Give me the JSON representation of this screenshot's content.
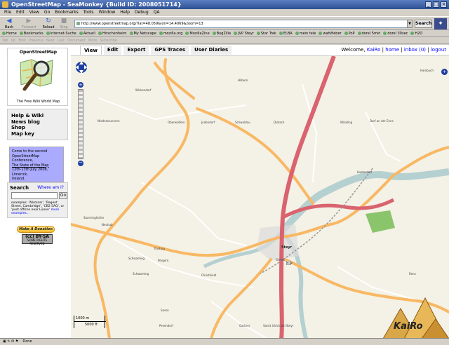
{
  "window": {
    "title": "OpenStreetMap - SeaMonkey {Build ID: 2008051714}"
  },
  "menu": [
    "File",
    "Edit",
    "View",
    "Go",
    "Bookmarks",
    "Tools",
    "Window",
    "Help",
    "Debug",
    "QA"
  ],
  "nav": {
    "back": "Back",
    "forward": "Forward",
    "reload": "Reload",
    "stop": "Stop",
    "url": "http://www.openstreetmap.org/?lat=48.059&lon=14.4069&zoom=13",
    "search": "Search"
  },
  "bookmarks": [
    "Home",
    "Bookmarks",
    "Internet-Suche",
    "Aktuell",
    "Hirschenheim",
    "My Netscape",
    "mozilla.org",
    "MozillaZine",
    "BugZilla",
    "JVP Steyr",
    "Star Trek",
    "ELBA",
    "mein tele",
    "wahlfieber",
    "PoP",
    "dorel 5min",
    "dorel 30sec",
    "H2O"
  ],
  "tabbar": [
    "Tab",
    "Up",
    "First",
    "Previous",
    "Next",
    "Last",
    "Document",
    "More",
    "Subscribe"
  ],
  "sidebar": {
    "logo_title": "OpenStreetMap",
    "logo_sub": "The Free Wiki World Map",
    "links": [
      "Help & Wiki",
      "News blog",
      "Shop",
      "Map key"
    ],
    "notice": [
      "Come to the second",
      "OpenStreetMap Conference,",
      "The State of the Map",
      "12th-13th July 2008, Limerick,",
      "Ireland."
    ],
    "search_title": "Search",
    "where_am_i": "Where am I?",
    "go": "Go",
    "examples": "examples: 'Alkmaar', 'Regent Street, Cambridge', 'CB2 5AQ', or 'post offices near Lünen'",
    "more_examples": "more examples...",
    "donate": "Make A Donation",
    "cc": "SOME RIGHTS RESERVED"
  },
  "tabs": [
    "View",
    "Edit",
    "Export",
    "GPS Traces",
    "User Diaries"
  ],
  "user": {
    "welcome": "Welcome,",
    "name": "KaiRo",
    "home": "home",
    "inbox": "inbox (0)",
    "logout": "logout"
  },
  "map": {
    "places": [
      "Wickendorf",
      "Hilbern",
      "Hainbuch",
      "Niederbrunnern",
      "Oberwolfern",
      "Judendorf",
      "Schwaldau",
      "Dietach",
      "Winkling",
      "Dorf an der Enns",
      "Hasterdorf",
      "Saarninghofen",
      "Neuhub",
      "Steyr",
      "Tinsting",
      "Schwaming",
      "Pergern",
      "Christkindl",
      "Schwaming",
      "Renz",
      "Gleink",
      "Sasso",
      "Pesendorf",
      "Gartner",
      "Sankt Ulrich bei Steyr",
      "Sierning",
      "Neustift"
    ],
    "scale_m": "1000 m",
    "scale_ft": "5000 ft",
    "route_shield": "B122"
  },
  "watermark": {
    "text": "KaiRo",
    "line": "KaiRo"
  },
  "status": "Done"
}
